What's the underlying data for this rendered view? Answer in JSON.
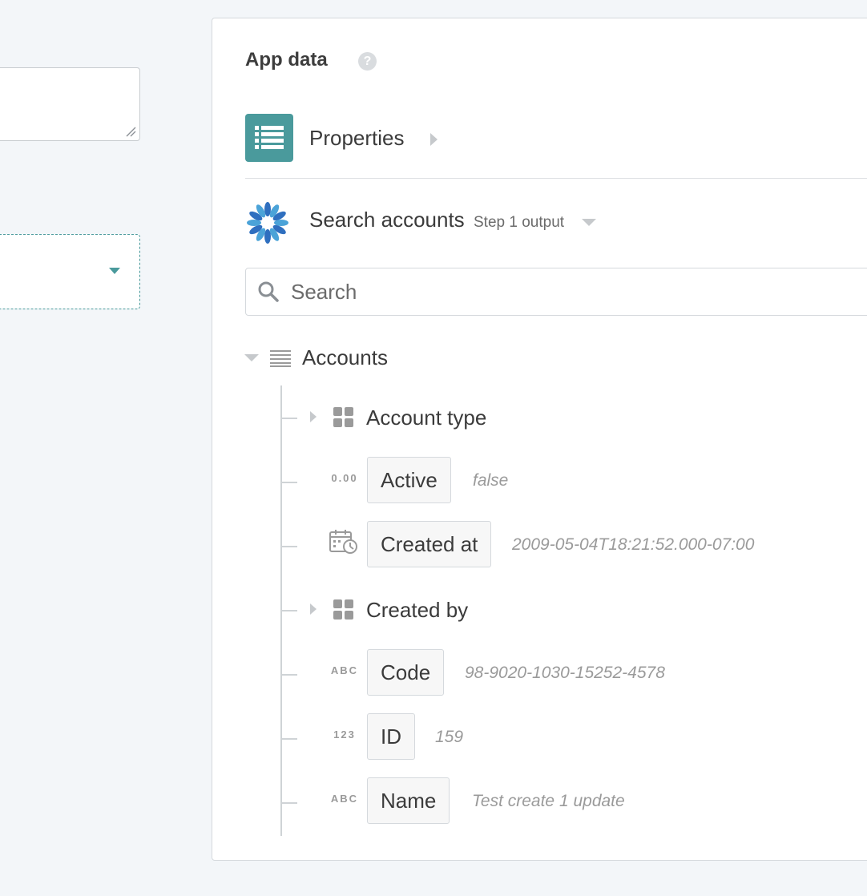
{
  "panel": {
    "title": "App data",
    "help_symbol": "?",
    "properties_label": "Properties",
    "app_name": "Search accounts",
    "step_output": "Step 1 output",
    "search_placeholder": "Search"
  },
  "tree": {
    "root_label": "Accounts",
    "fields": [
      {
        "kind": "object",
        "label": "Account type"
      },
      {
        "kind": "field",
        "type_label": "0.00",
        "label": "Active",
        "sample": "false"
      },
      {
        "kind": "field",
        "type_label": "date",
        "label": "Created at",
        "sample": "2009-05-04T18:21:52.000-07:00"
      },
      {
        "kind": "object",
        "label": "Created by"
      },
      {
        "kind": "field",
        "type_label": "ABC",
        "label": "Code",
        "sample": "98-9020-1030-15252-4578"
      },
      {
        "kind": "field",
        "type_label": "123",
        "label": "ID",
        "sample": "159"
      },
      {
        "kind": "field",
        "type_label": "ABC",
        "label": "Name",
        "sample": "Test create 1 update"
      }
    ]
  },
  "colors": {
    "accent": "#4a9a9c",
    "background": "#f3f6f9",
    "muted_text": "#9a9a9a"
  }
}
